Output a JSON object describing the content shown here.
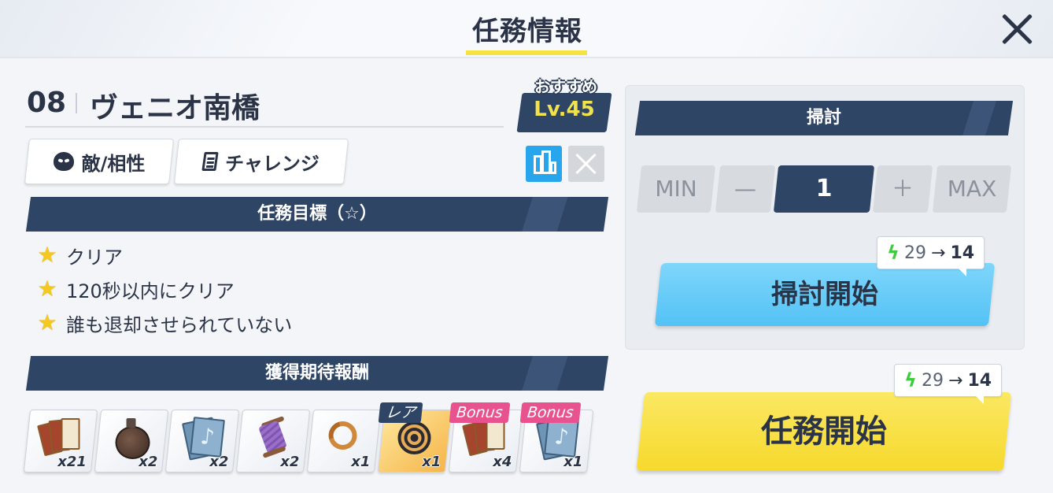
{
  "header": {
    "title": "任務情報"
  },
  "stage": {
    "number": "08",
    "name": "ヴェニオ南橋"
  },
  "recommend": {
    "label": "おすすめ",
    "level": "Lv.45"
  },
  "tabs": {
    "enemy": "敵/相性",
    "challenge": "チャレンジ"
  },
  "objectives": {
    "title": "任務目標（☆）",
    "items": [
      "クリア",
      "120秒以内にクリア",
      "誰も退却させられていない"
    ]
  },
  "rewards": {
    "title": "獲得期待報酬",
    "items": [
      {
        "name": "cards-icon",
        "qty": "x21",
        "tag": ""
      },
      {
        "name": "potion-icon",
        "qty": "x2",
        "tag": ""
      },
      {
        "name": "music-card-icon",
        "qty": "x2",
        "tag": ""
      },
      {
        "name": "thread-spool-icon",
        "qty": "x2",
        "tag": ""
      },
      {
        "name": "ring-icon",
        "qty": "x1",
        "tag": ""
      },
      {
        "name": "target-disc-icon",
        "qty": "x1",
        "tag": "レア"
      },
      {
        "name": "cards-icon",
        "qty": "x4",
        "tag": "Bonus"
      },
      {
        "name": "music-card-icon",
        "qty": "x1",
        "tag": "Bonus"
      }
    ]
  },
  "sweep": {
    "title": "掃討",
    "min": "MIN",
    "minus": "—",
    "count": "1",
    "plus": "＋",
    "max": "MAX",
    "ap_from": "29",
    "ap_to": "14",
    "arrow": "→",
    "start": "掃討開始"
  },
  "mission": {
    "ap_from": "29",
    "ap_to": "14",
    "arrow": "→",
    "start": "任務開始"
  },
  "colors": {
    "navy": "#2f4566",
    "sky": "#53c2f5",
    "yellow": "#f6d92c",
    "bonus": "#e8538f"
  }
}
